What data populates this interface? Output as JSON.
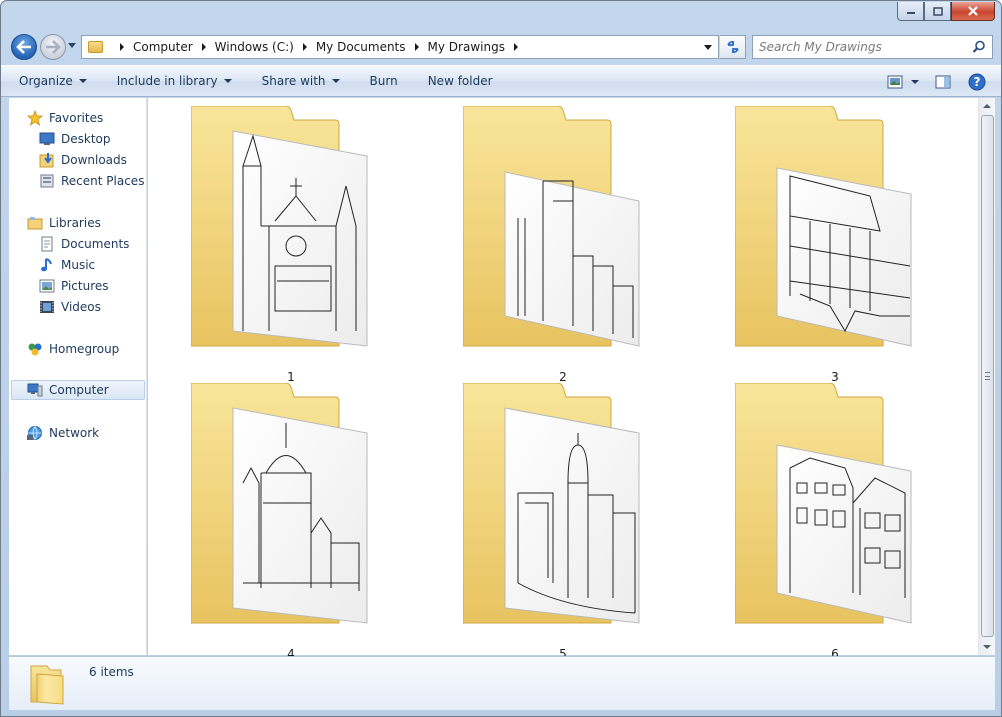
{
  "window": {
    "minimize": "▭",
    "maximize": "▢",
    "close": "✕"
  },
  "address": {
    "breadcrumbs": [
      "Computer",
      "Windows (C:)",
      "My Documents",
      "My Drawings"
    ]
  },
  "search": {
    "placeholder": "Search My Drawings"
  },
  "toolbar": {
    "organize": "Organize",
    "include_in_library": "Include in library",
    "share_with": "Share with",
    "burn": "Burn",
    "new_folder": "New folder"
  },
  "sidebar": {
    "favorites": "Favorites",
    "desktop": "Desktop",
    "downloads": "Downloads",
    "recent_places": "Recent Places",
    "libraries": "Libraries",
    "documents": "Documents",
    "music": "Music",
    "pictures": "Pictures",
    "videos": "Videos",
    "homegroup": "Homegroup",
    "computer": "Computer",
    "network": "Network"
  },
  "folders": [
    {
      "name": "1"
    },
    {
      "name": "2"
    },
    {
      "name": "3"
    },
    {
      "name": "4"
    },
    {
      "name": "5"
    },
    {
      "name": "6"
    }
  ],
  "details": {
    "count": "6 items"
  }
}
